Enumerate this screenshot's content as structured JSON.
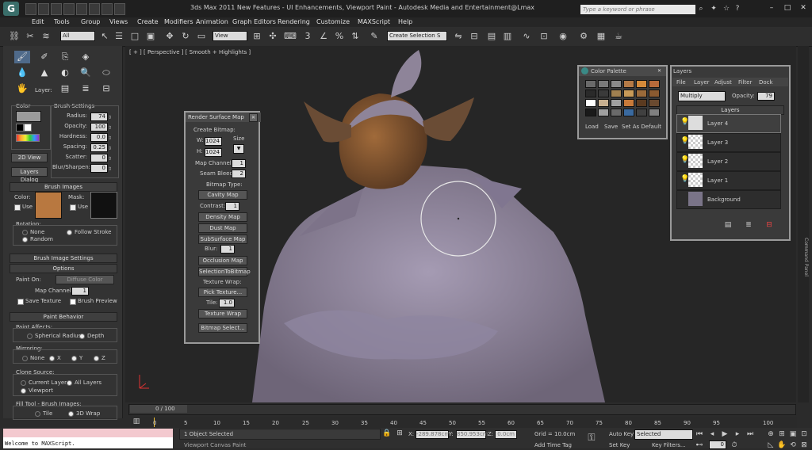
{
  "window": {
    "title": "3ds Max 2011 New Features - UI Enhancements, Viewport Paint - Autodesk Media and Entertainment@Lmax",
    "search_placeholder": "Type a keyword or phrase"
  },
  "menus": [
    "Edit",
    "Tools",
    "Group",
    "Views",
    "Create",
    "Modifiers",
    "Animation",
    "Graph Editors",
    "Rendering",
    "Customize",
    "MAXScript",
    "Help"
  ],
  "toolbar": {
    "selection_filter": "All",
    "ref_coord": "View",
    "named_selection": "Create Selection S"
  },
  "left_panel": {
    "layer_label": "Layer:",
    "color_label": "Color",
    "brush_settings_label": "Brush Settings",
    "settings": [
      {
        "label": "Radius:",
        "value": "74"
      },
      {
        "label": "Opacity:",
        "value": "100"
      },
      {
        "label": "Hardness:",
        "value": "0.0"
      },
      {
        "label": "Spacing:",
        "value": "0.25"
      },
      {
        "label": "Scatter:",
        "value": "0"
      },
      {
        "label": "Blur/Sharpen:",
        "value": "0"
      }
    ],
    "view_2d": "2D View",
    "layers_dialog": "Layers Dialog",
    "brush_images_title": "Brush Images",
    "color_lbl": "Color:",
    "mask_lbl": "Mask:",
    "use_lbl": "Use",
    "rotation_lbl": "Rotation:",
    "rot_none": "None",
    "rot_follow": "Follow Stroke",
    "rot_random": "Random",
    "brush_image_settings": "Brush Image Settings",
    "options_title": "Options",
    "paint_on_lbl": "Paint On:",
    "paint_on_value": "Diffuse Color",
    "map_channel_lbl": "Map Channel:",
    "map_channel_value": "1",
    "save_texture": "Save Texture",
    "brush_preview": "Brush Preview",
    "paint_behavior_title": "Paint Behavior",
    "paint_affects_lbl": "Paint Affects:",
    "spherical_radius": "Spherical Radius",
    "depth": "Depth",
    "mirroring_lbl": "Mirroring:",
    "mir_none": "None",
    "mir_x": "X",
    "mir_y": "Y",
    "mir_z": "Z",
    "clone_source_lbl": "Clone Source:",
    "current_layer": "Current Layer",
    "all_layers": "All Layers",
    "viewport_lbl": "Viewport",
    "fill_tool_lbl": "Fill Tool - Brush Images:",
    "tile": "Tile",
    "wrap_3d": "3D Wrap"
  },
  "viewport": {
    "label": "[ + ] [ Perspective ] [ Smooth + Highlights ]"
  },
  "render_surface_map": {
    "title": "Render Surface Map",
    "create_bitmap": "Create Bitmap:",
    "w_label": "W:",
    "w_value": "1024",
    "h_label": "H:",
    "h_value": "1024",
    "size_label": "Size",
    "map_channel_lbl": "Map Channel:",
    "map_channel_value": "1",
    "seam_bleed_lbl": "Seam Bleed:",
    "seam_bleed_value": "2",
    "bitmap_type": "Bitmap Type:",
    "cavity_map": "Cavity Map",
    "contrast_lbl": "Contrast:",
    "contrast_value": "1",
    "density_map": "Density Map",
    "dust_map": "Dust Map",
    "subsurface_map": "SubSurface Map",
    "blur_lbl": "Blur:",
    "blur_value": "1",
    "occlusion_map": "Occlusion Map",
    "selection_to_bitmap": "SelectionToBitmap",
    "texture_wrap_lbl": "Texture Wrap:",
    "pick_texture": "Pick Texture...",
    "tile_lbl": "Tile:",
    "tile_value": "1.0",
    "texture_wrap_btn": "Texture Wrap",
    "bitmap_select": "Bitmap Select..."
  },
  "color_palette": {
    "title": "Color Palette",
    "swatches": [
      "#6a6a6a",
      "#7a7a7a",
      "#8a8a8a",
      "#b57a46",
      "#d48a3a",
      "#b86a3a",
      "#2a2a2a",
      "#3a3a3a",
      "#a08050",
      "#c89a58",
      "#9a6a3a",
      "#8a5a30",
      "#ffffff",
      "#c8b090",
      "#a0a0a0",
      "#c87a3a",
      "#5a3a20",
      "#6a4a30",
      "#1a1a1a",
      "#a0a0a0",
      "#6a6a6a",
      "#3a6aa0",
      "#404040",
      "#808080"
    ],
    "load": "Load",
    "save": "Save",
    "set_default": "Set As Default"
  },
  "layers_panel": {
    "title": "Layers",
    "menu": [
      "File",
      "Layer",
      "Adjust",
      "Filter",
      "Dock"
    ],
    "blend_mode": "Multiply",
    "opacity_lbl": "Opacity:",
    "opacity_value": "79",
    "header": "Layers",
    "layers": [
      "Layer 4",
      "Layer 3",
      "Layer 2",
      "Layer 1",
      "Background"
    ]
  },
  "command_panel_tab": "Command Panel",
  "timeline": {
    "frame_display": "0 / 100",
    "ticks": [
      "0",
      "5",
      "10",
      "15",
      "20",
      "25",
      "30",
      "35",
      "40",
      "45",
      "50",
      "55",
      "60",
      "65",
      "70",
      "75",
      "80",
      "85",
      "90",
      "95",
      "100"
    ]
  },
  "status": {
    "maxscript_text": "Welcome to MAXScript.",
    "selection": "1 Object Selected",
    "x_label": "X:",
    "x_value": "-289.878cm",
    "y_label": "Y:",
    "y_value": "850.953cm",
    "z_label": "Z:",
    "z_value": "0.0cm",
    "grid": "Grid = 10.0cm",
    "auto_key": "Auto Key",
    "key_mode": "Selected",
    "set_key": "Set Key",
    "key_filters": "Key Filters...",
    "prompt": "Viewport Canvas Paint",
    "add_time_tag": "Add Time Tag",
    "current_frame": "0"
  }
}
